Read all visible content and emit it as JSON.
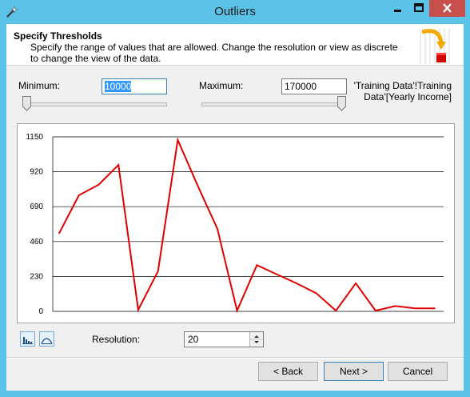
{
  "window": {
    "title": "Outliers"
  },
  "header": {
    "title": "Specify Thresholds",
    "description": "Specify the range of values that are allowed.  Change the resolution or view as discrete to change the view of the data."
  },
  "range": {
    "min_label": "Minimum:",
    "min_value": "10000",
    "max_label": "Maximum:",
    "max_value": "170000",
    "column": "'Training Data'!Training Data'[Yearly Income]",
    "min_slider_fraction": 0.0,
    "max_slider_fraction": 1.0
  },
  "chart_data": {
    "type": "line",
    "y_ticks": [
      "0",
      "230",
      "460",
      "690",
      "920",
      "1150"
    ],
    "ylim": [
      0,
      1150
    ],
    "grid": true,
    "series": [
      {
        "color": "#e00000",
        "values": [
          515,
          765,
          835,
          965,
          10,
          265,
          1130,
          830,
          545,
          5,
          305,
          245,
          185,
          120,
          5,
          185,
          5,
          35,
          20,
          20
        ]
      }
    ]
  },
  "resolution": {
    "label": "Resolution:",
    "value": "20"
  },
  "buttons": {
    "back": "< Back",
    "next": "Next >",
    "cancel": "Cancel"
  }
}
